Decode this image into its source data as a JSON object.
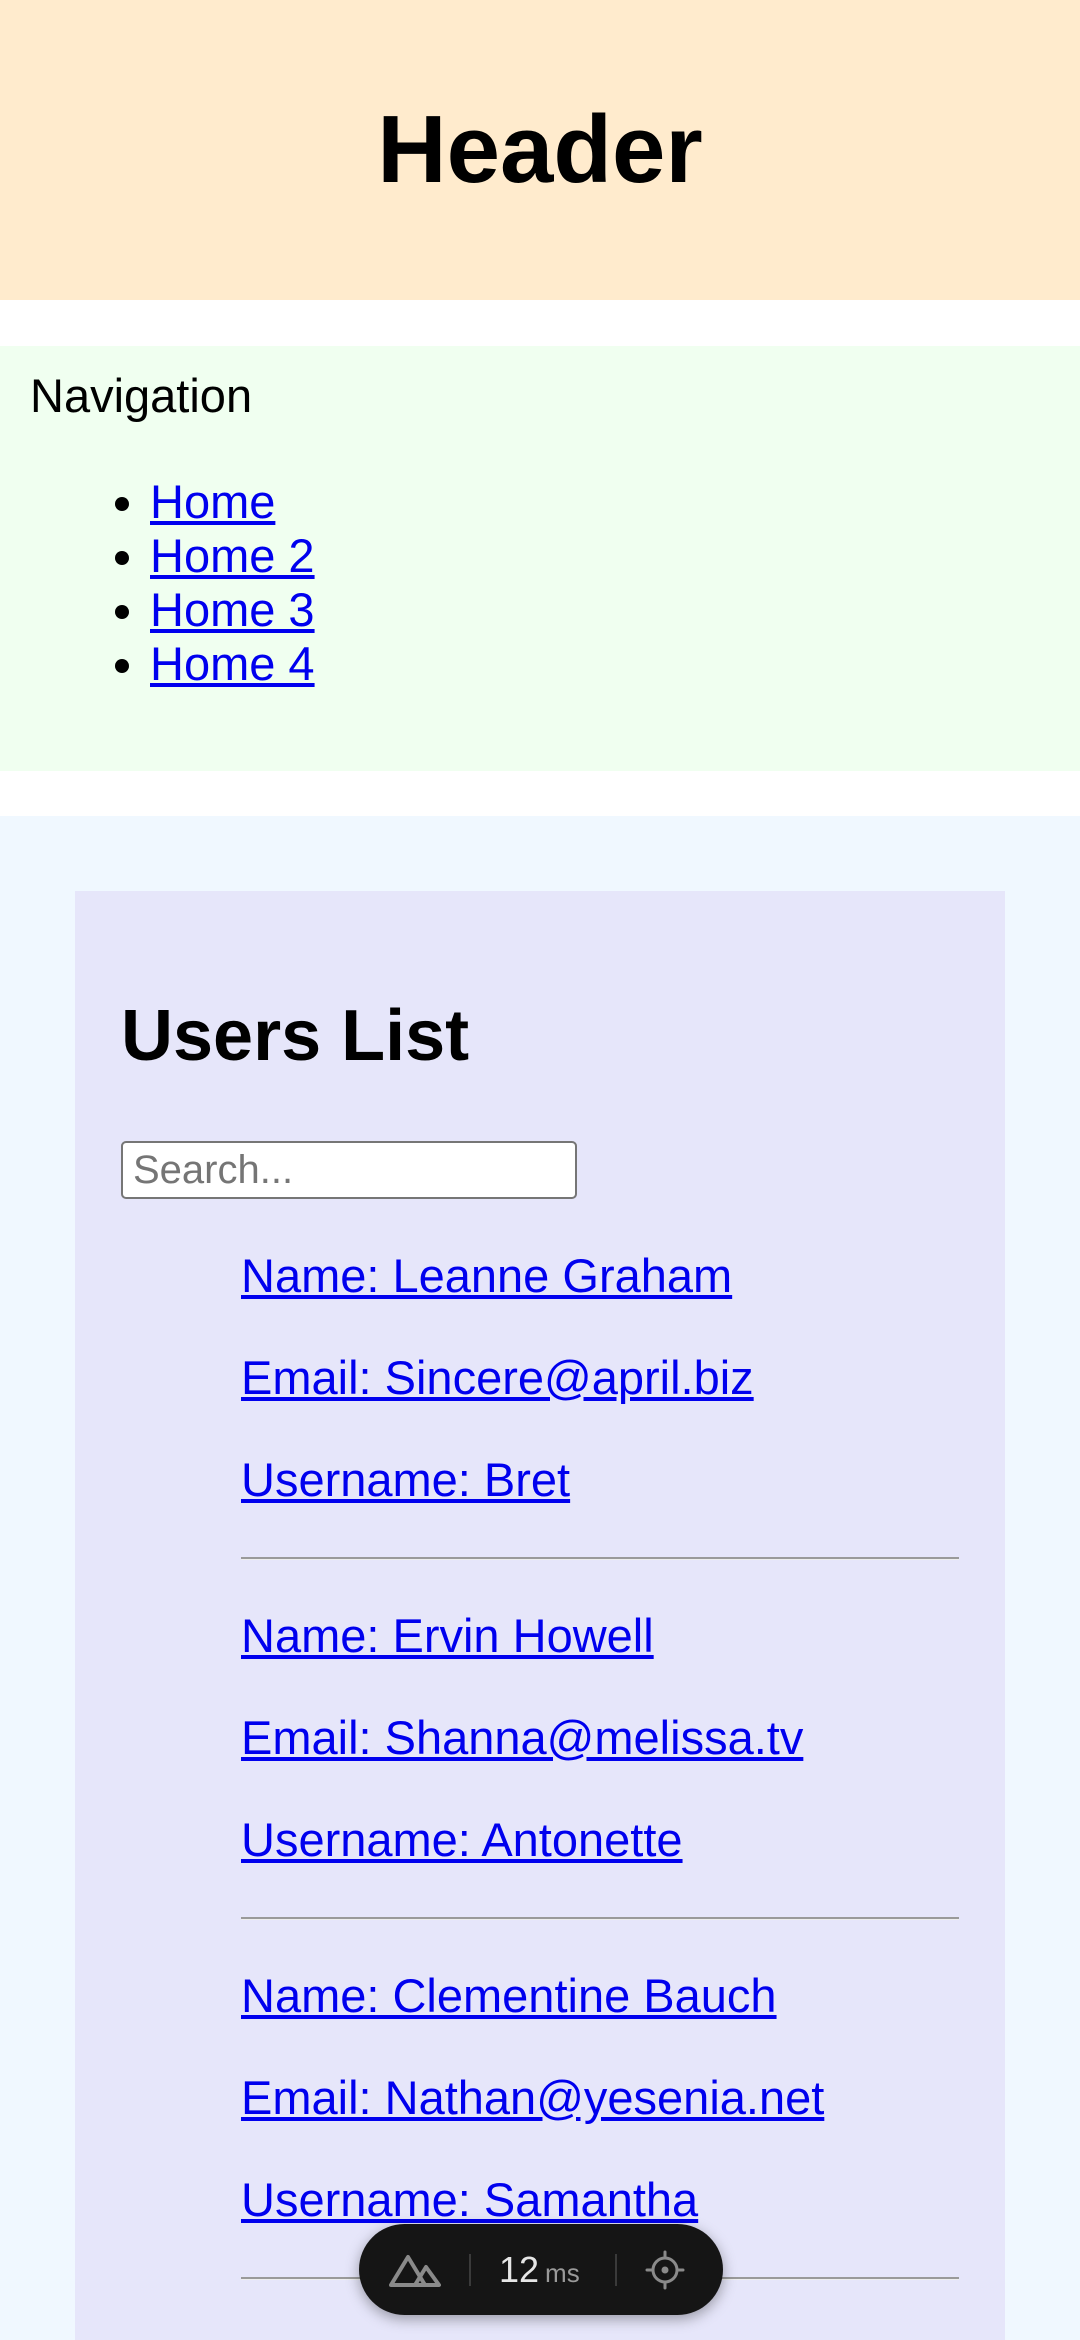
{
  "header": {
    "title": "Header"
  },
  "navigation": {
    "title": "Navigation",
    "links": [
      "Home",
      "Home 2",
      "Home 3",
      "Home 4"
    ]
  },
  "users_section": {
    "title": "Users List",
    "search_placeholder": "Search...",
    "users": [
      {
        "name": "Name: Leanne Graham",
        "email": "Email: Sincere@april.biz",
        "username": "Username: Bret"
      },
      {
        "name": "Name: Ervin Howell",
        "email": "Email: Shanna@melissa.tv",
        "username": "Username: Antonette"
      },
      {
        "name": "Name: Clementine Bauch",
        "email": "Email: Nathan@yesenia.net",
        "username": "Username: Samantha"
      }
    ]
  },
  "devtools": {
    "value": "12",
    "unit": "ms"
  },
  "colors": {
    "header_bg": "#ffebcd",
    "nav_bg": "#f0fff0",
    "main_bg": "#f0f8ff",
    "card_bg": "#e6e6fa",
    "link": "#0000ee"
  },
  "icons": [
    "nuxt-logo-icon",
    "crosshair-icon"
  ]
}
